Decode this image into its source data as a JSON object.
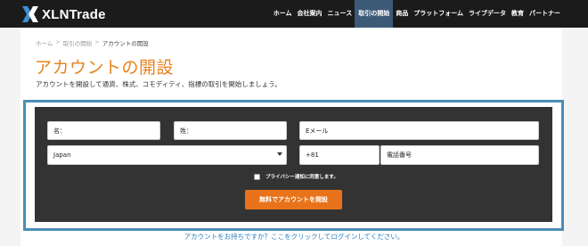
{
  "brand": {
    "name": "XLNTrade"
  },
  "nav": {
    "items": [
      {
        "label": "ホーム",
        "active": false
      },
      {
        "label": "会社案内",
        "active": false
      },
      {
        "label": "ニュース",
        "active": false
      },
      {
        "label": "取引の開始",
        "active": true
      },
      {
        "label": "商品",
        "active": false
      },
      {
        "label": "プラットフォーム",
        "active": false
      },
      {
        "label": "ライブデータ",
        "active": false
      },
      {
        "label": "教育",
        "active": false
      },
      {
        "label": "パートナー",
        "active": false
      }
    ]
  },
  "breadcrumb": {
    "home": "ホーム",
    "parent": "取引の開始",
    "current": "アカウントの開設",
    "separator": ">"
  },
  "page": {
    "title": "アカウントの開設",
    "intro": "アカウントを開設して通貨、株式、コモディティ、指標の取引を開始しましょう。"
  },
  "form": {
    "first_name_placeholder": "名：",
    "last_name_placeholder": "姓：",
    "email_placeholder": "Eメール",
    "country_value": "Japan",
    "phone_code_value": "+81",
    "phone_placeholder": "電話番号",
    "consent_label": "プライバシー通知に同意します。",
    "submit_label": "無料でアカウントを開設"
  },
  "login_link": "アカウントをお持ちですか？ここをクリックしてログインしてください。",
  "colors": {
    "topbar": "#1b1b1b",
    "nav_active": "#3c5a78",
    "accent_orange": "#e8831e",
    "button_orange": "#e8731a",
    "panel": "#333333",
    "frame_blue": "#4a8fb5",
    "link_blue": "#2a7fc1",
    "logo_blue": "#3d8fd6"
  },
  "icons": {
    "logo": "xln-x-logo-icon",
    "select_arrow": "chevron-down-icon"
  }
}
